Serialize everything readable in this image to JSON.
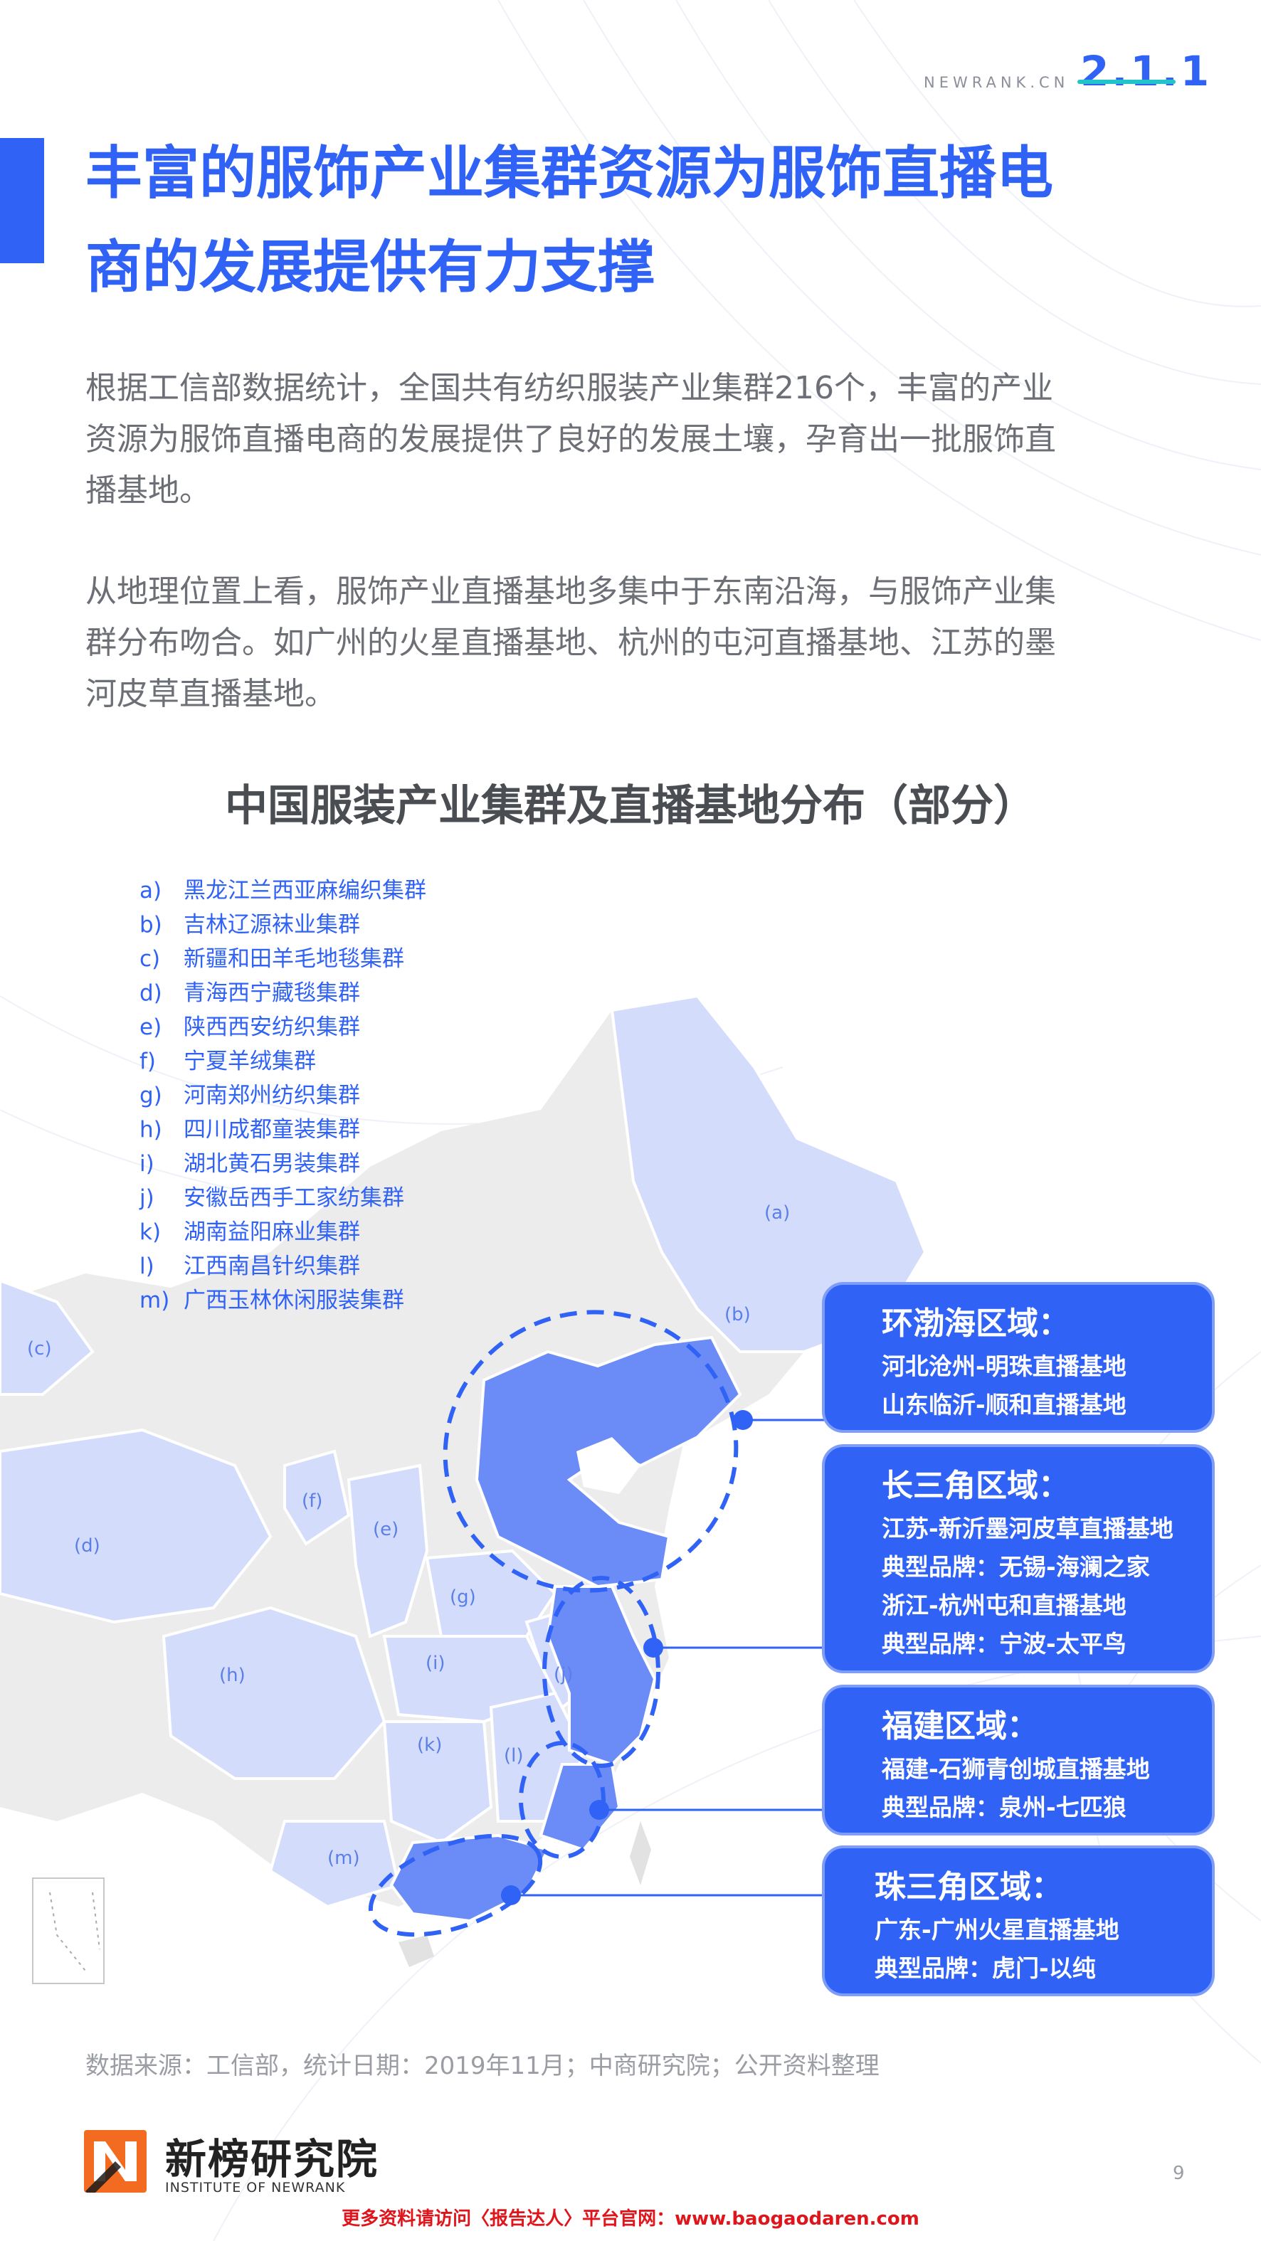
{
  "header": {
    "brand": "NEWRANK.CN",
    "section_number": "2.1.1"
  },
  "title": {
    "line1": "丰富的服饰产业集群资源为服饰直播电",
    "line2": "商的发展提供有力支撑"
  },
  "paragraphs": [
    {
      "line1": "根据工信部数据统计，全国共有纺织服装产业集群216个，丰富的产业",
      "line2": "资源为服饰直播电商的发展提供了良好的发展土壤，孕育出一批服饰直",
      "line3": "播基地。"
    },
    {
      "line1": "从地理位置上看，服饰产业直播基地多集中于东南沿海，与服饰产业集",
      "line2": "群分布吻合。如广州的火星直播基地、杭州的屯河直播基地、江苏的墨",
      "line3": "河皮草直播基地。"
    }
  ],
  "map": {
    "title": "中国服装产业集群及直播基地分布（部分）",
    "legend": [
      {
        "key": "a)",
        "text": "黑龙江兰西亚麻编织集群"
      },
      {
        "key": "b)",
        "text": "吉林辽源袜业集群"
      },
      {
        "key": "c)",
        "text": "新疆和田羊毛地毯集群"
      },
      {
        "key": "d)",
        "text": "青海西宁藏毯集群"
      },
      {
        "key": "e)",
        "text": "陕西西安纺织集群"
      },
      {
        "key": "f)",
        "text": "宁夏羊绒集群"
      },
      {
        "key": "g)",
        "text": "河南郑州纺织集群"
      },
      {
        "key": "h)",
        "text": "四川成都童装集群"
      },
      {
        "key": "i)",
        "text": "湖北黄石男装集群"
      },
      {
        "key": "j)",
        "text": "安徽岳西手工家纺集群"
      },
      {
        "key": "k)",
        "text": "湖南益阳麻业集群"
      },
      {
        "key": "l)",
        "text": "江西南昌针织集群"
      },
      {
        "key": "m)",
        "text": "广西玉林休闲服装集群"
      }
    ],
    "markers": {
      "a": "(a)",
      "b": "(b)",
      "c": "(c)",
      "d": "(d)",
      "e": "(e)",
      "f": "(f)",
      "g": "(g)",
      "h": "(h)",
      "i": "(i)",
      "j": "(j)",
      "k": "(k)",
      "l": "(l)",
      "m": "(m)"
    },
    "regions": [
      {
        "title": "环渤海区域：",
        "lines": [
          "河北沧州-明珠直播基地",
          "山东临沂-顺和直播基地"
        ]
      },
      {
        "title": "长三角区域：",
        "lines": [
          "江苏-新沂墨河皮草直播基地",
          "典型品牌：无锡-海澜之家",
          "浙江-杭州屯和直播基地",
          "典型品牌：宁波-太平鸟"
        ]
      },
      {
        "title": "福建区域：",
        "lines": [
          "福建-石狮青创城直播基地",
          "典型品牌：泉州-七匹狼"
        ]
      },
      {
        "title": "珠三角区域：",
        "lines": [
          "广东-广州火星直播基地",
          "典型品牌：虎门-以纯"
        ]
      }
    ],
    "colors": {
      "highlight": "#6b8cf7",
      "light_region": "#d3ddfb",
      "base_land": "#ececec",
      "accent": "#2f62f5"
    }
  },
  "source": "数据来源：工信部，统计日期：2019年11月；中商研究院；公开资料整理",
  "logo": {
    "name": "新榜研究院",
    "subtitle": "INSTITUTE OF NEWRANK"
  },
  "page_number": "9",
  "footer_note": "更多资料请访问〈报告达人〉平台官网：www.baogaodaren.com"
}
